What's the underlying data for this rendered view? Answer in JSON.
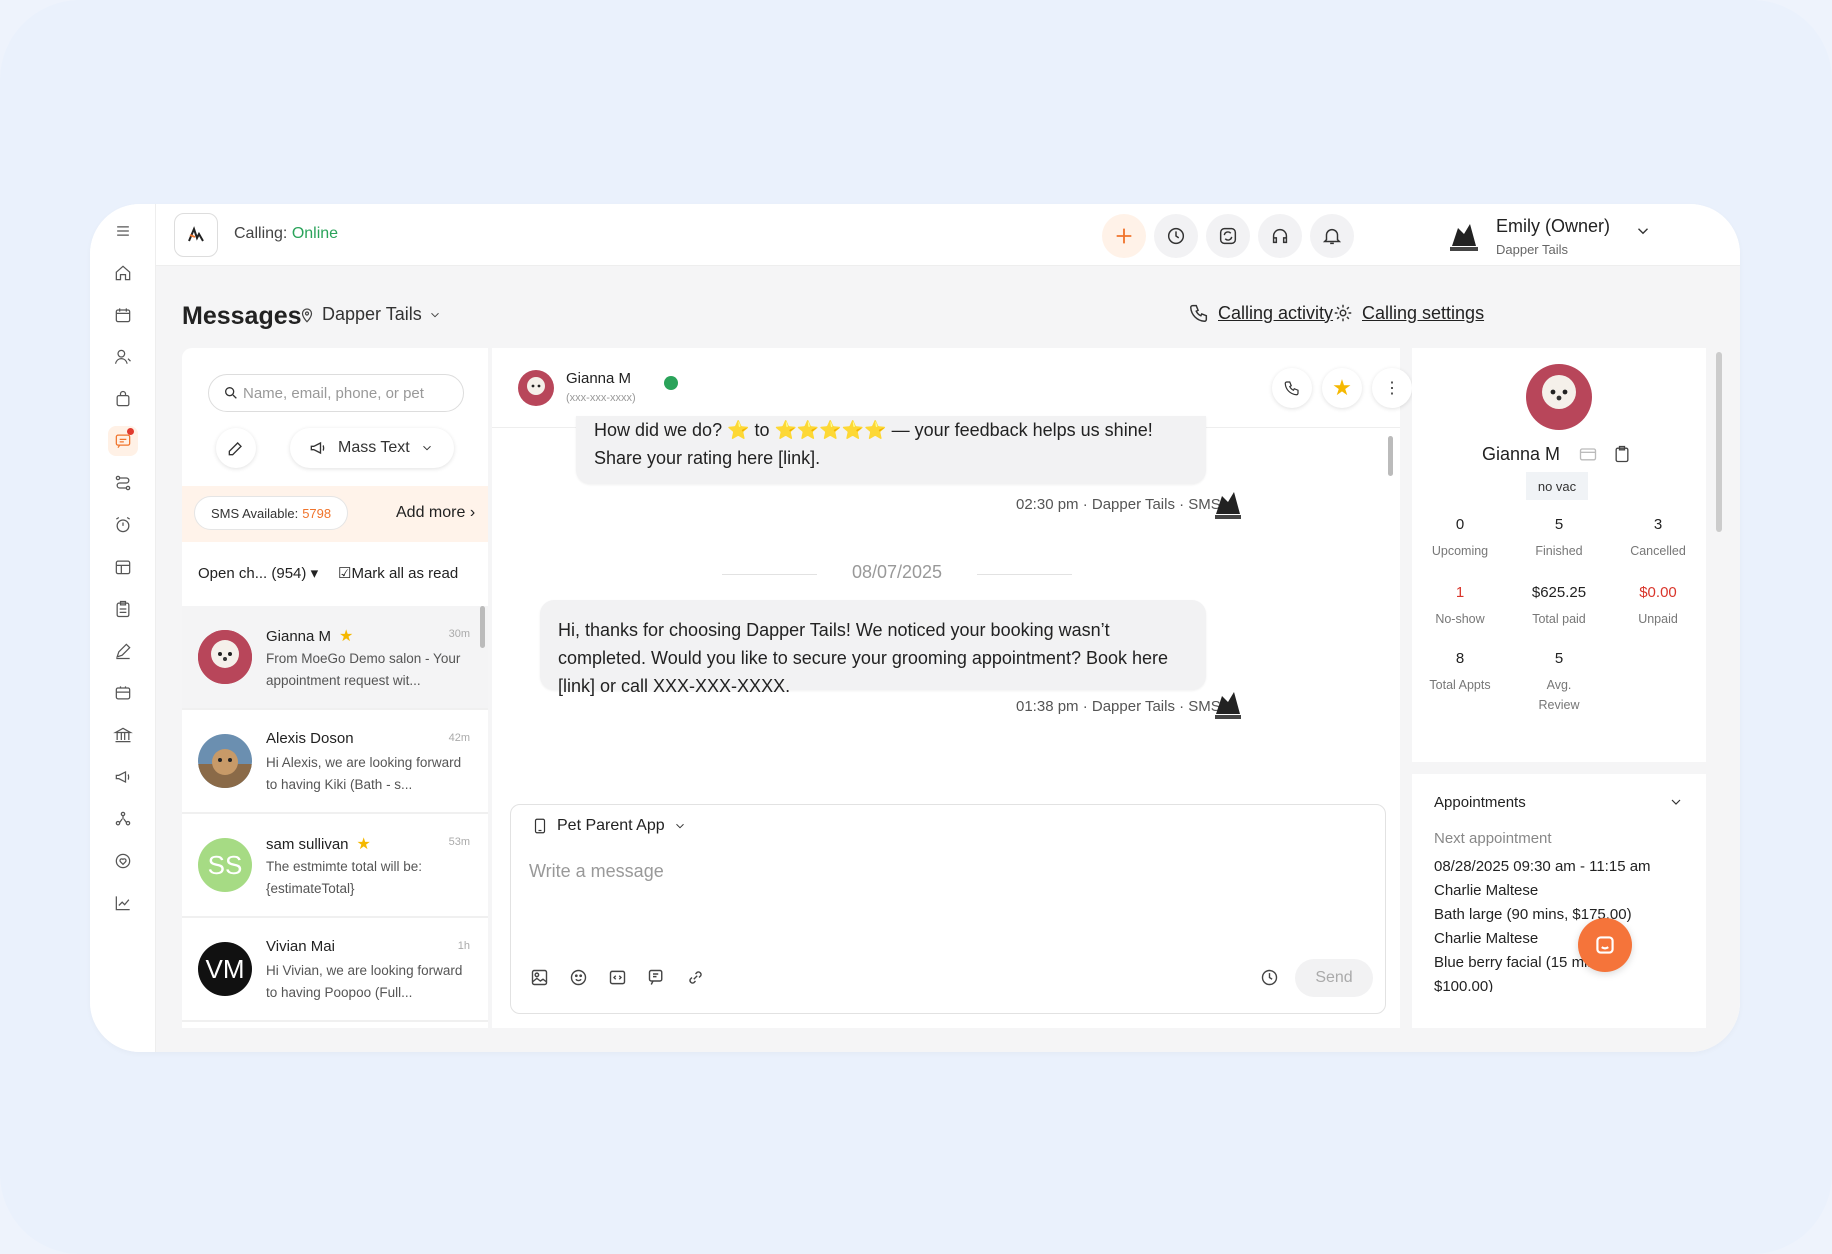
{
  "topbar": {
    "calling_label": "Calling:",
    "calling_status": "Online",
    "user_name": "Emily (Owner)",
    "user_business": "Dapper Tails"
  },
  "header": {
    "title": "Messages",
    "location": "Dapper Tails",
    "calling_activity": "Calling activity",
    "calling_settings": "Calling settings"
  },
  "list": {
    "search_placeholder": "Name, email, phone, or pet",
    "mass_text": "Mass Text",
    "sms_available_label": "SMS Available:",
    "sms_available_count": "5798",
    "add_more": "Add more",
    "filter": "Open ch...  (954)",
    "mark_all": "Mark all as read",
    "conversations": [
      {
        "name": "Gianna M",
        "time": "30m",
        "preview": "From MoeGo Demo salon - Your appointment request wit...",
        "starred": true
      },
      {
        "name": "Alexis Doson",
        "time": "42m",
        "preview": "Hi Alexis, we are looking forward to having Kiki (Bath - s...",
        "starred": false
      },
      {
        "name": "sam sullivan",
        "time": "53m",
        "preview": "The estmimte total will be:{estimateTotal}",
        "starred": true,
        "initials": "SS"
      },
      {
        "name": "Vivian Mai",
        "time": "1h",
        "preview": "Hi Vivian, we are looking forward to having Poopoo (Full...",
        "starred": false,
        "initials": "VM"
      }
    ]
  },
  "chat": {
    "contact_name": "Gianna M",
    "contact_phone": "(xxx-xxx-xxxx)",
    "msg1": "How did we do? ⭐ to ⭐⭐⭐⭐⭐ — your feedback helps us shine! Share your rating here [link].",
    "msg1_meta": "02:30 pm · Dapper Tails · SMS",
    "date_sep": "08/07/2025",
    "msg2": "Hi, thanks for choosing Dapper Tails! We noticed your booking wasn’t completed. Would you like to secure your grooming appointment? Book here [link] or call XXX-XXX-XXXX.",
    "msg2_meta": "01:38 pm · Dapper Tails · SMS",
    "channel": "Pet Parent App",
    "placeholder": "Write a message",
    "send": "Send"
  },
  "profile": {
    "name": "Gianna M",
    "tag": "no vac",
    "stats": {
      "upcoming_v": "0",
      "upcoming_l": "Upcoming",
      "finished_v": "5",
      "finished_l": "Finished",
      "cancelled_v": "3",
      "cancelled_l": "Cancelled",
      "noshow_v": "1",
      "noshow_l": "No-show",
      "totalpaid_v": "$625.25",
      "totalpaid_l": "Total paid",
      "unpaid_v": "$0.00",
      "unpaid_l": "Unpaid",
      "totalappts_v": "8",
      "totalappts_l": "Total Appts",
      "review_v": "5",
      "review_l": "Avg. Review"
    }
  },
  "appointments": {
    "title": "Appointments",
    "next_label": "Next appointment",
    "lines": [
      "08/28/2025 09:30 am - 11:15 am",
      "Charlie Maltese",
      "Bath large (90 mins, $175.00)",
      "Charlie Maltese",
      "Blue berry facial (15 mins,",
      "$100.00)"
    ]
  },
  "colors": {
    "accent": "#f0742c",
    "online": "#2aa35a",
    "red": "#d9352b",
    "star": "#f5b800"
  }
}
